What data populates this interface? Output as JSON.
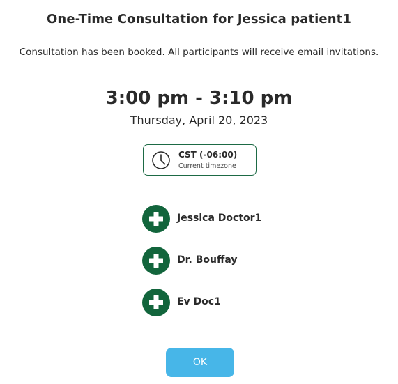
{
  "dialog": {
    "title": "One-Time Consultation for Jessica patient1",
    "message": "Consultation has been booked. All participants will receive email invitations.",
    "time_range": "3:00 pm - 3:10 pm",
    "date": "Thursday, April 20, 2023",
    "timezone": {
      "code": "CST (-06:00)",
      "label": "Current timezone",
      "icon": "clock-icon"
    },
    "participants": [
      {
        "name": "Jessica Doctor1",
        "icon": "plus-icon"
      },
      {
        "name": "Dr. Bouffay",
        "icon": "plus-icon"
      },
      {
        "name": "Ev Doc1",
        "icon": "plus-icon"
      }
    ],
    "ok_label": "OK"
  },
  "colors": {
    "accent_green": "#12653c",
    "button_blue": "#47b6e8",
    "text": "#2a2a2a"
  }
}
